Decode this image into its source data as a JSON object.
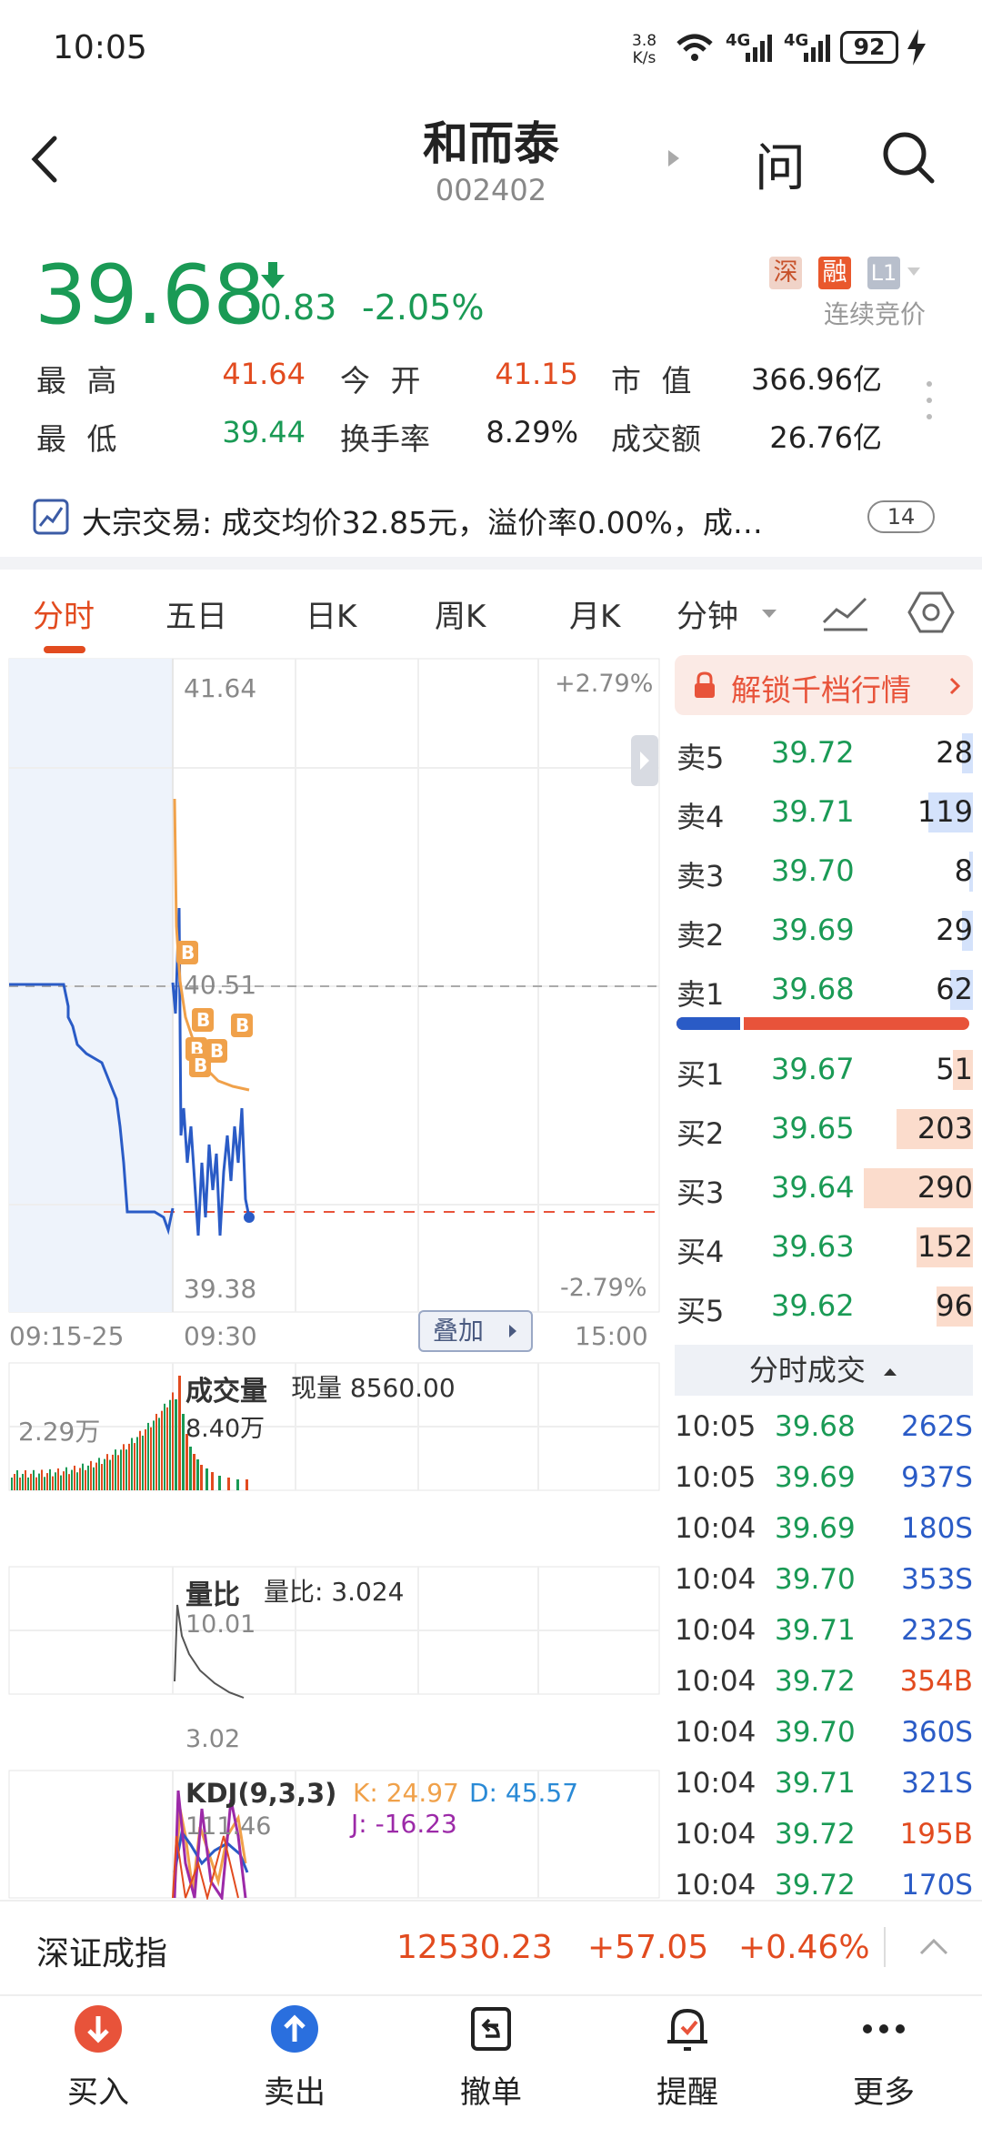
{
  "status": {
    "time": "10:05",
    "net_speed": "3.8\nK/s",
    "net1": "4G",
    "net2": "4G",
    "battery": "92"
  },
  "header": {
    "title": "和而泰",
    "code": "002402",
    "ask_label": "问"
  },
  "quote": {
    "price": "39.68",
    "change": "-0.83",
    "change_pct": "-2.05%",
    "badges": [
      "深",
      "融",
      "L1"
    ],
    "mode": "连续竞价",
    "high_label": "最 高",
    "high": "41.64",
    "open_label": "今 开",
    "open": "41.15",
    "mcap_label": "市 值",
    "mcap": "366.96亿",
    "low_label": "最 低",
    "low": "39.44",
    "turnover_label": "换手率",
    "turnover": "8.29%",
    "amount_label": "成交额",
    "amount": "26.76亿"
  },
  "notice": {
    "text": "大宗交易: 成交均价32.85元，溢价率0.00%，成…",
    "count": "14"
  },
  "tabs": [
    "分时",
    "五日",
    "日K",
    "周K",
    "月K",
    "分钟"
  ],
  "chart": {
    "top_price": "41.64",
    "top_pct": "+2.79%",
    "mid_price": "40.51",
    "bottom_price": "39.38",
    "bottom_pct": "-2.79%",
    "time_start": "09:15-25",
    "time_open": "09:30",
    "time_end": "15:00",
    "overlay_btn": "叠加",
    "volume_title": "成交量",
    "volume_now": "现量 8560.00",
    "volume_max": "8.40万",
    "volume_left": "2.29万",
    "ratio_title": "量比",
    "ratio_now": "量比: 3.024",
    "ratio_max": "10.01",
    "ratio_min": "3.02",
    "kdj_title": "KDJ(9,3,3)",
    "kdj_k": "K: 24.97",
    "kdj_d": "D: 45.57",
    "kdj_j": "J: -16.23",
    "kdj_max": "111.46"
  },
  "unlock": {
    "text": "解锁千档行情"
  },
  "orderbook": {
    "asks": [
      {
        "label": "卖5",
        "price": "39.72",
        "qty": "28",
        "w": 0.1
      },
      {
        "label": "卖4",
        "price": "39.71",
        "qty": "119",
        "w": 0.41
      },
      {
        "label": "卖3",
        "price": "39.70",
        "qty": "8",
        "w": 0.03
      },
      {
        "label": "卖2",
        "price": "39.69",
        "qty": "29",
        "w": 0.1
      },
      {
        "label": "卖1",
        "price": "39.68",
        "qty": "62",
        "w": 0.21
      }
    ],
    "bids": [
      {
        "label": "买1",
        "price": "39.67",
        "qty": "51",
        "w": 0.18
      },
      {
        "label": "买2",
        "price": "39.65",
        "qty": "203",
        "w": 0.7
      },
      {
        "label": "买3",
        "price": "39.64",
        "qty": "290",
        "w": 1.0
      },
      {
        "label": "买4",
        "price": "39.63",
        "qty": "152",
        "w": 0.52
      },
      {
        "label": "买5",
        "price": "39.62",
        "qty": "96",
        "w": 0.33
      }
    ],
    "ratio_buy": 0.23
  },
  "trades_header": "分时成交",
  "trades": [
    {
      "t": "10:05",
      "p": "39.68",
      "v": "262S",
      "side": "S"
    },
    {
      "t": "10:05",
      "p": "39.69",
      "v": "937S",
      "side": "S"
    },
    {
      "t": "10:04",
      "p": "39.69",
      "v": "180S",
      "side": "S"
    },
    {
      "t": "10:04",
      "p": "39.70",
      "v": "353S",
      "side": "S"
    },
    {
      "t": "10:04",
      "p": "39.71",
      "v": "232S",
      "side": "S"
    },
    {
      "t": "10:04",
      "p": "39.72",
      "v": "354B",
      "side": "B"
    },
    {
      "t": "10:04",
      "p": "39.70",
      "v": "360S",
      "side": "S"
    },
    {
      "t": "10:04",
      "p": "39.71",
      "v": "321S",
      "side": "S"
    },
    {
      "t": "10:04",
      "p": "39.72",
      "v": "195B",
      "side": "B"
    },
    {
      "t": "10:04",
      "p": "39.72",
      "v": "170S",
      "side": "S"
    }
  ],
  "index": {
    "name": "深证成指",
    "value": "12530.23",
    "change": "+57.05",
    "pct": "+0.46%"
  },
  "nav": [
    "买入",
    "卖出",
    "撤单",
    "提醒",
    "更多"
  ],
  "colors": {
    "up": "#e24b1f",
    "down": "#1a9a55",
    "accent": "#e8533a",
    "blue": "#2a5bc6"
  }
}
